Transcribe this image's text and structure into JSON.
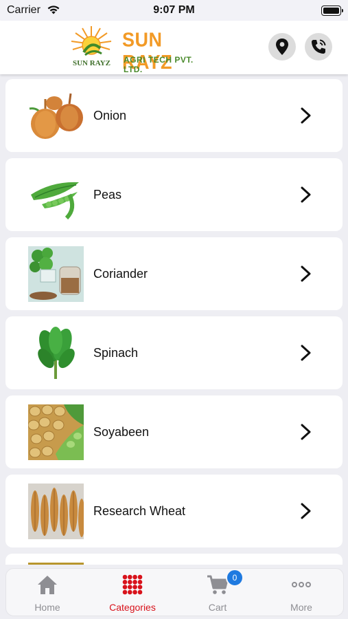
{
  "status_bar": {
    "carrier": "Carrier",
    "time": "9:07 PM"
  },
  "header": {
    "logo_title": "SUN RAYZ",
    "logo_subtitle": "AGRI TECH PVT. LTD.",
    "logo_small_text": "SUN RAYZ",
    "location_icon": "location-pin-icon",
    "call_icon": "phone-call-icon"
  },
  "categories": [
    {
      "label": "Onion",
      "icon": "onion-image"
    },
    {
      "label": "Peas",
      "icon": "peas-image"
    },
    {
      "label": "Coriander",
      "icon": "coriander-image"
    },
    {
      "label": "Spinach",
      "icon": "spinach-image"
    },
    {
      "label": "Soyabeen",
      "icon": "soyabeen-image"
    },
    {
      "label": "Research Wheat",
      "icon": "wheat-image"
    }
  ],
  "tab_bar": {
    "tabs": [
      {
        "label": "Home",
        "icon": "home-icon"
      },
      {
        "label": "Categories",
        "icon": "grid-dots-icon",
        "active": true
      },
      {
        "label": "Cart",
        "icon": "cart-icon",
        "badge": "0"
      },
      {
        "label": "More",
        "icon": "more-dots-icon"
      }
    ]
  },
  "colors": {
    "accent": "#d8121b",
    "badge": "#1f7ae0",
    "logo_orange": "#f29a26",
    "logo_green": "#4a8a2c"
  }
}
